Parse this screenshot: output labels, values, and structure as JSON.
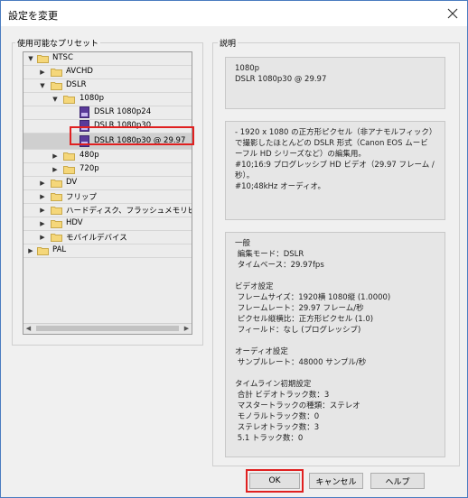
{
  "window": {
    "title": "設定を変更"
  },
  "presets": {
    "label": "使用可能なプリセット",
    "tree": [
      {
        "label": "NTSC"
      },
      {
        "label": "AVCHD"
      },
      {
        "label": "DSLR"
      },
      {
        "label": "1080p"
      },
      {
        "label": "DSLR 1080p24"
      },
      {
        "label": "DSLR 1080p30"
      },
      {
        "label": "DSLR 1080p30 @ 29.97"
      },
      {
        "label": "480p"
      },
      {
        "label": "720p"
      },
      {
        "label": "DV"
      },
      {
        "label": "フリップ"
      },
      {
        "label": "ハードディスク、フラッシュメモリビデオ..."
      },
      {
        "label": "HDV"
      },
      {
        "label": "モバイルデバイス"
      },
      {
        "label": "PAL"
      }
    ]
  },
  "description": {
    "label": "説明",
    "summary": "1080p\nDSLR 1080p30 @ 29.97",
    "detail": "- 1920 x 1080 の正方形ピクセル（非アナモルフィック）で撮影したほとんどの DSLR 形式（Canon EOS ムービーフル HD シリーズなど）の編集用。\n#10;16:9 プログレッシブ HD ビデオ（29.97 フレーム / 秒）。\n#10;48kHz オーディオ。",
    "specs": "一般\n 編集モード：DSLR\n タイムベース：29.97fps\n\nビデオ設定\n フレームサイズ：1920横 1080縦 (1.0000)\n フレームレート：29.97 フレーム/秒\n ピクセル縦横比：正方形ピクセル (1.0)\n フィールド：なし (プログレッシブ)\n\nオーディオ設定\n サンプルレート：48000 サンプル/秒\n\nタイムライン初期設定\n 合計 ビデオトラック数：3\n マスタートラックの種類：ステレオ\n モノラルトラック数：0\n ステレオトラック数：3\n 5.1 トラック数：0"
  },
  "buttons": {
    "ok": "OK",
    "cancel": "キャンセル",
    "help": "ヘルプ"
  },
  "colors": {
    "highlight": "#e02020",
    "folder": "#f5d77a",
    "file": "#5a3a9a"
  }
}
